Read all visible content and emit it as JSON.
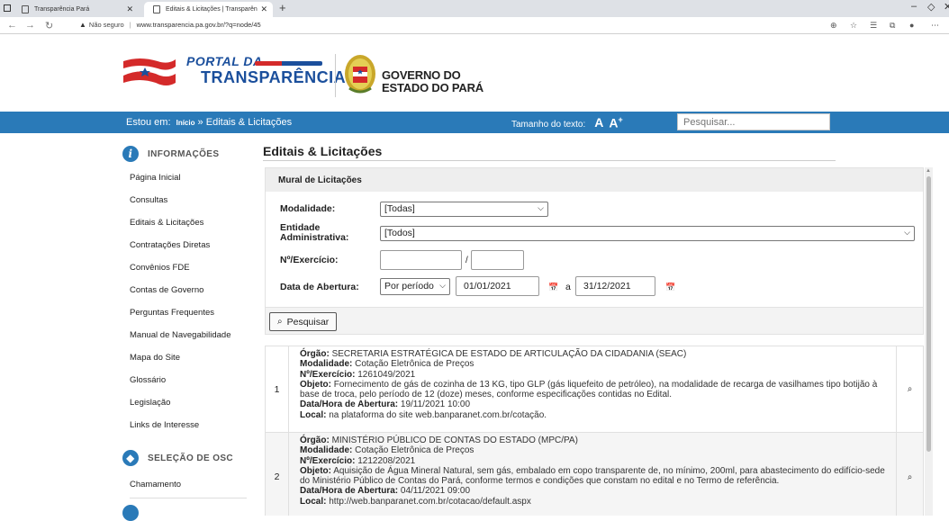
{
  "browser": {
    "tabs": [
      {
        "label": "Transparência Pará"
      },
      {
        "label": "Editais & Licitações | Transparên"
      }
    ],
    "address": {
      "warning": "Não seguro",
      "url": "www.transparencia.pa.gov.br/?q=node/45"
    }
  },
  "header": {
    "portal_line1": "PORTAL DA",
    "portal_line2": "TRANSPARÊNCIA",
    "gov_line1": "GOVERNO DO",
    "gov_line2": "ESTADO DO PARÁ"
  },
  "bluebar": {
    "crumb_prefix": "Estou em:",
    "crumb_home": "Início",
    "crumb_sep": "»",
    "crumb_current": "Editais & Licitações",
    "fontsize_label": "Tamanho do texto:",
    "font_smaller": "A",
    "font_larger": "A",
    "search_placeholder": "Pesquisar..."
  },
  "sidebar": {
    "section1": "INFORMAÇÕES",
    "items": [
      "Página Inicial",
      "Consultas",
      "Editais & Licitações",
      "Contratações Diretas",
      "Convênios FDE",
      "Contas de Governo",
      "Perguntas Frequentes",
      "Manual de Navegabilidade",
      "Mapa do Site",
      "Glossário",
      "Legislação",
      "Links de Interesse"
    ],
    "section2": "SELEÇÃO DE OSC",
    "items2": [
      "Chamamento"
    ]
  },
  "main": {
    "title": "Editais & Licitações",
    "mural_title": "Mural de Licitações",
    "form": {
      "modalidade_label": "Modalidade:",
      "modalidade_value": "[Todas]",
      "entidade_label_1": "Entidade",
      "entidade_label_2": "Administrativa:",
      "entidade_value": "[Todos]",
      "numero_label": "Nº/Exercício:",
      "numero_value": "",
      "exercicio_value": "",
      "slash": "/",
      "data_label": "Data de Abertura:",
      "periodo_value": "Por período",
      "data_inicio": "01/01/2021",
      "a_label": "a",
      "data_fim": "31/12/2021"
    },
    "search_button": "Pesquisar"
  },
  "results": [
    {
      "index": "1",
      "orgao_label": "Órgão:",
      "orgao": "SECRETARIA ESTRATÉGICA DE ESTADO DE ARTICULAÇÃO DA CIDADANIA (SEAC)",
      "modalidade_label": "Modalidade:",
      "modalidade": "Cotação Eletrônica de Preços",
      "numero_label": "Nº/Exercício:",
      "numero": "1261049/2021",
      "objeto_label": "Objeto:",
      "objeto": "Fornecimento de gás de cozinha de 13 KG, tipo GLP (gás liquefeito de petróleo), na modalidade de recarga de vasilhames tipo botijão à base de troca, pelo período de 12 (doze) meses, conforme especificações contidas no Edital.",
      "data_label": "Data/Hora de Abertura:",
      "data": "19/11/2021 10:00",
      "local_label": "Local:",
      "local": "na plataforma do site web.banparanet.com.br/cotação."
    },
    {
      "index": "2",
      "orgao_label": "Órgão:",
      "orgao": "MINISTÉRIO PÚBLICO DE CONTAS DO ESTADO (MPC/PA)",
      "modalidade_label": "Modalidade:",
      "modalidade": "Cotação Eletrônica de Preços",
      "numero_label": "Nº/Exercício:",
      "numero": "1212208/2021",
      "objeto_label": "Objeto:",
      "objeto": "Aquisição de Água Mineral Natural, sem gás, embalado em copo transparente de, no mínimo, 200ml, para abastecimento do edifício-sede do Ministério Público de Contas do Pará, conforme termos e condições que constam no edital e no Termo de referência.",
      "data_label": "Data/Hora de Abertura:",
      "data": "04/11/2021 09:00",
      "local_label": "Local:",
      "local": "http://web.banparanet.com.br/cotacao/default.aspx"
    }
  ]
}
